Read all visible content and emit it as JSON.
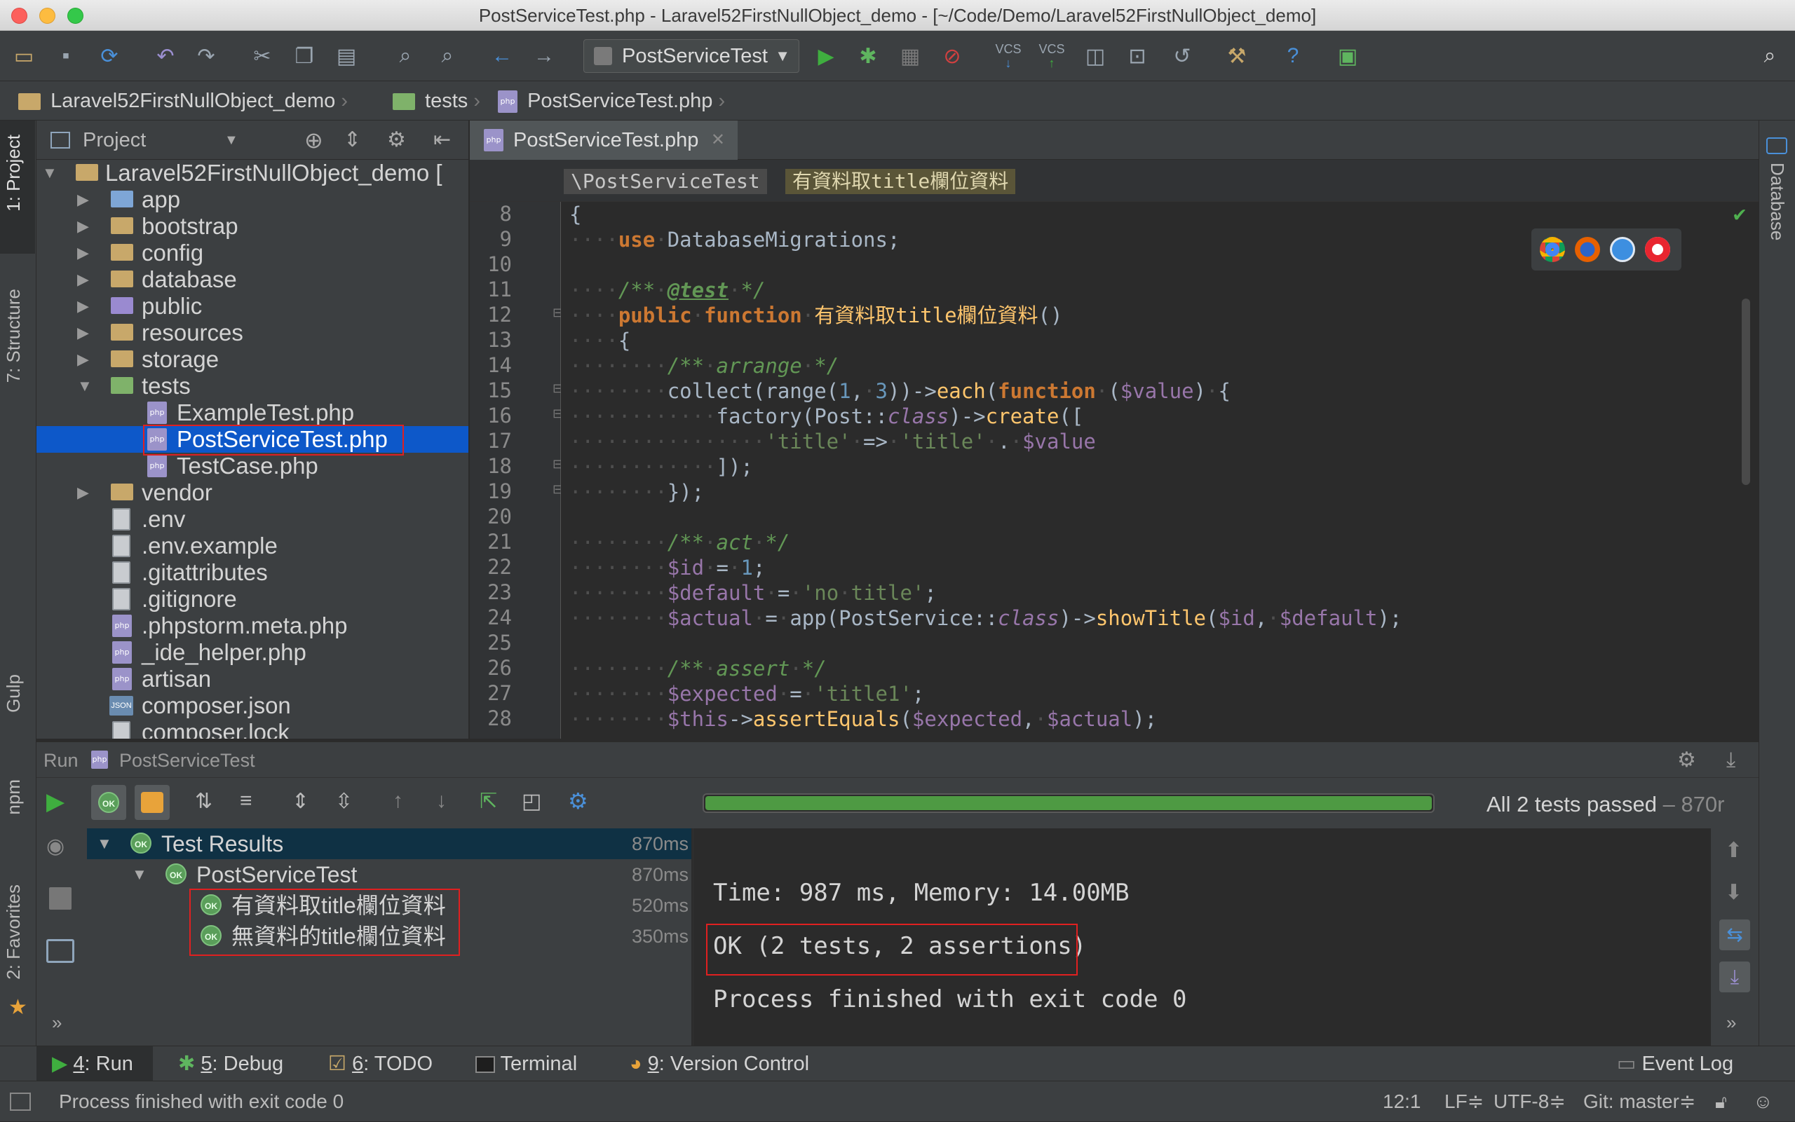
{
  "window": {
    "title": "PostServiceTest.php - Laravel52FirstNullObject_demo - [~/Code/Demo/Laravel52FirstNullObject_demo]"
  },
  "toolbar": {
    "run_config": "PostServiceTest",
    "vcs1": "VCS",
    "vcs2": "VCS"
  },
  "navbar": {
    "crumbs": [
      "Laravel52FirstNullObject_demo",
      "tests",
      "PostServiceTest.php"
    ]
  },
  "left_strip": {
    "project": "1: Project",
    "structure": "7: Structure",
    "gulp": "Gulp",
    "npm": "npm",
    "favorites": "2: Favorites"
  },
  "right_strip": {
    "database": "Database"
  },
  "project_panel": {
    "title": "Project",
    "tree": [
      {
        "label": "Laravel52FirstNullObject_demo [",
        "type": "folder"
      },
      {
        "label": "app",
        "type": "folder"
      },
      {
        "label": "bootstrap",
        "type": "folder"
      },
      {
        "label": "config",
        "type": "folder"
      },
      {
        "label": "database",
        "type": "folder"
      },
      {
        "label": "public",
        "type": "folder"
      },
      {
        "label": "resources",
        "type": "folder"
      },
      {
        "label": "storage",
        "type": "folder"
      },
      {
        "label": "tests",
        "type": "folder"
      },
      {
        "label": "ExampleTest.php",
        "type": "php"
      },
      {
        "label": "PostServiceTest.php",
        "type": "php"
      },
      {
        "label": "TestCase.php",
        "type": "php"
      },
      {
        "label": "vendor",
        "type": "folder"
      },
      {
        "label": ".env",
        "type": "file"
      },
      {
        "label": ".env.example",
        "type": "file"
      },
      {
        "label": ".gitattributes",
        "type": "file"
      },
      {
        "label": ".gitignore",
        "type": "file"
      },
      {
        "label": ".phpstorm.meta.php",
        "type": "php"
      },
      {
        "label": "_ide_helper.php",
        "type": "php"
      },
      {
        "label": "artisan",
        "type": "php"
      },
      {
        "label": "composer.json",
        "type": "json"
      },
      {
        "label": "composer.lock",
        "type": "file"
      }
    ]
  },
  "editor": {
    "tab": "PostServiceTest.php",
    "breadcrumb_class": "\\PostServiceTest",
    "breadcrumb_method": "有資料取title欄位資料",
    "line_numbers": [
      "8",
      "9",
      "10",
      "11",
      "12",
      "13",
      "14",
      "15",
      "16",
      "17",
      "18",
      "19",
      "20",
      "21",
      "22",
      "23",
      "24",
      "25",
      "26",
      "27",
      "28"
    ]
  },
  "run": {
    "header_label": "Run",
    "header_config": "PostServiceTest",
    "status": "All 2 tests passed",
    "status_time": "– 870r",
    "results": [
      {
        "label": "Test Results",
        "time": "870ms"
      },
      {
        "label": "PostServiceTest",
        "time": "870ms"
      },
      {
        "label": "有資料取title欄位資料",
        "time": "520ms"
      },
      {
        "label": "無資料的title欄位資料",
        "time": "350ms"
      }
    ],
    "console": [
      "Time: 987 ms, Memory: 14.00MB",
      "OK (2 tests, 2 assertions)",
      "Process finished with exit code 0"
    ]
  },
  "bottom_tabs": {
    "run_num": "4",
    "run": ": Run",
    "debug_num": "5",
    "debug": ": Debug",
    "todo_num": "6",
    "todo": ": TODO",
    "terminal": "Terminal",
    "vcs_num": "9",
    "vcs": ": Version Control",
    "event_log": "Event Log"
  },
  "status_bar": {
    "message": "Process finished with exit code 0",
    "position": "12:1",
    "line_sep": "LF",
    "encoding": "UTF-8",
    "git": "Git: master"
  },
  "colors": {
    "selection": "#0d58c9",
    "progress": "#4e9a43",
    "highlight_box": "#e02020"
  }
}
